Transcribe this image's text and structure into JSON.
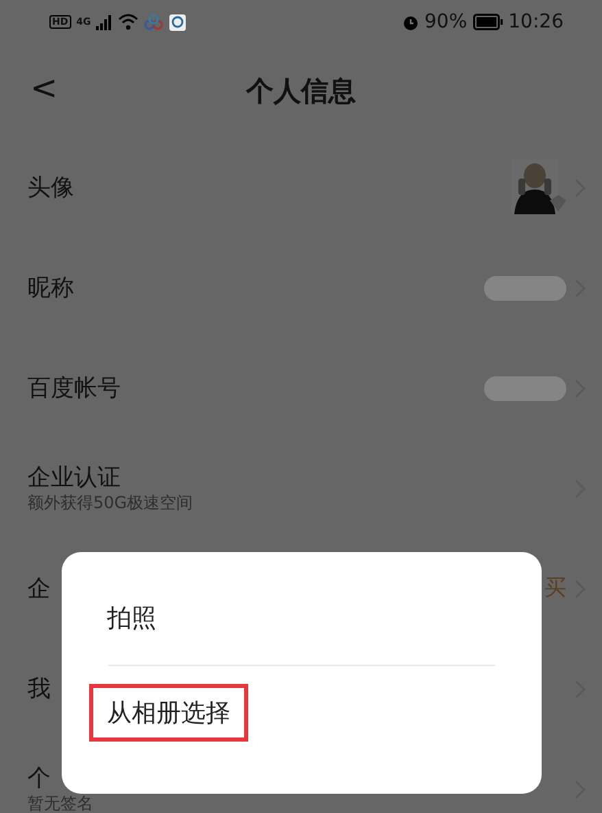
{
  "status_bar": {
    "left": [
      "HD",
      "4G"
    ],
    "battery": "90%",
    "time": "10:26"
  },
  "header": {
    "back": "<",
    "title": "个人信息"
  },
  "rows": [
    {
      "kind": "avatar",
      "label": "头像"
    },
    {
      "kind": "blurred",
      "label": "昵称"
    },
    {
      "kind": "blurred",
      "label": "百度帐号"
    },
    {
      "kind": "none",
      "label": "企业认证",
      "subtitle": "额外获得50G极速空间"
    },
    {
      "kind": "text",
      "label": "企",
      "value": "买"
    },
    {
      "kind": "none",
      "label": "我"
    },
    {
      "kind": "none",
      "label": "个",
      "subtitle": "暂无签名"
    }
  ],
  "dialog": {
    "options": [
      {
        "label": "拍照",
        "highlighted": false
      },
      {
        "label": "从相册选择",
        "highlighted": true
      }
    ]
  }
}
